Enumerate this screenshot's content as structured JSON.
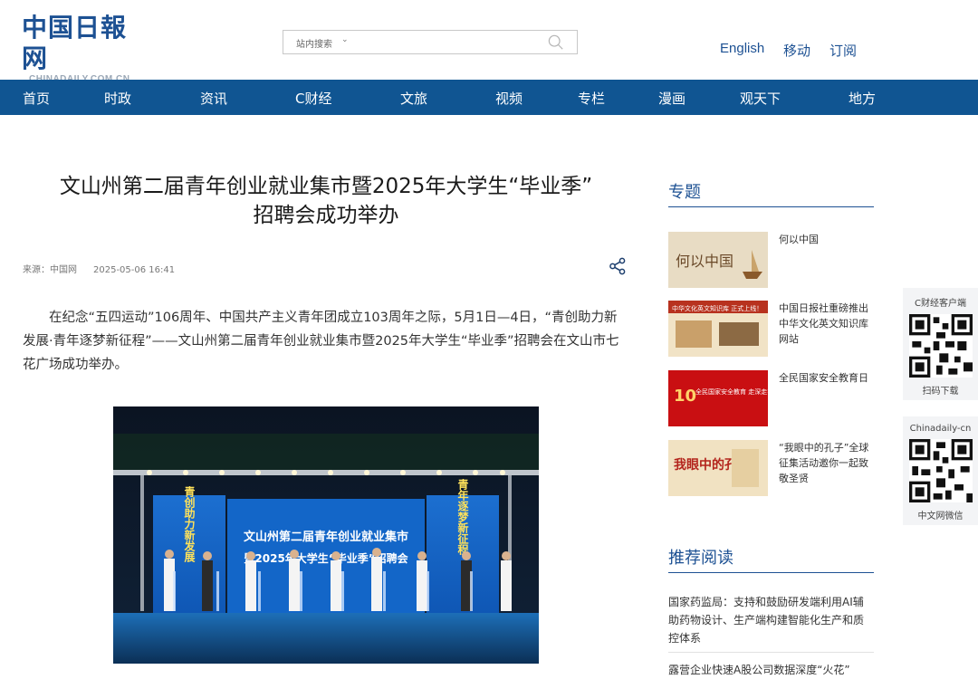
{
  "header": {
    "logo_cn": "中国日報网",
    "logo_en": "CHINADAILY.COM.CN",
    "search_scope": "站内搜索",
    "top_links": [
      "English",
      "移动",
      "订阅"
    ]
  },
  "nav": {
    "items": [
      "首页",
      "时政",
      "资讯",
      "C财经",
      "文旅",
      "视频",
      "专栏",
      "漫画",
      "观天下",
      "地方"
    ]
  },
  "article": {
    "title_line1": "文山州第二届青年创业就业集市暨2025年大学生“毕业季”",
    "title_line2": "招聘会成功举办",
    "source": "来源：中国网",
    "date": "2025-05-06 16:41",
    "paragraph": "在纪念“五四运动”106周年、中国共产主义青年团成立103周年之际，5月1日—4日，“青创助力新发展·青年逐梦新征程”——文山州第二届青年创业就业集市暨2025年大学生“毕业季”招聘会在文山市七花广场成功举办。",
    "photo": {
      "screen_line1": "文山州第二届青年创业就业集市",
      "screen_line2": "暨2025年大学生“毕业季”招聘会",
      "left_banner": "青创助力新发展",
      "right_banner": "青年逐梦新征程"
    }
  },
  "sidebar": {
    "topics_title": "专题",
    "topics": [
      {
        "text": "何以中国",
        "thumb_text": "何以中国"
      },
      {
        "text": "中国日报社重磅推出中华文化英文知识库网站",
        "thumb_text": "中华文化英文知识库 正式上线！"
      },
      {
        "text": "全民国家安全教育日",
        "thumb_text": "全民国家安全教育 走深走实十周年"
      },
      {
        "text": "“我眼中的孔子”全球征集活动邀你一起致敬圣贤",
        "thumb_text": "我眼中的孔子"
      }
    ],
    "recommend_title": "推荐阅读",
    "recommend": [
      "国家药监局：支持和鼓励研发端利用AI辅助药物设计、生产端构建智能化生产和质控体系",
      "露营企业快速A股公司数据深度“火花”"
    ]
  },
  "float_panel": [
    {
      "title": "C财经客户端",
      "caption": "扫码下载"
    },
    {
      "title": "Chinadaily-cn",
      "caption": "中文网微信"
    }
  ],
  "colors": {
    "brand": "#105592",
    "accent_red": "#c40000"
  }
}
